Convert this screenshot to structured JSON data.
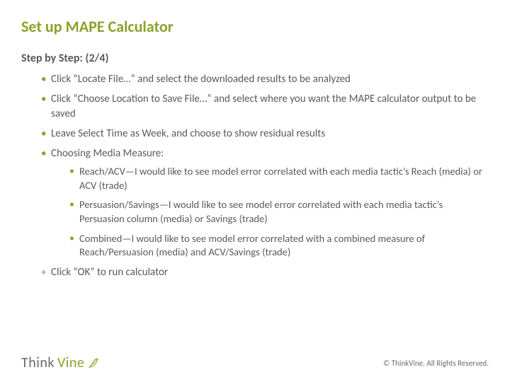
{
  "title": "Set up MAPE Calculator",
  "subtitle": "Step by Step: (2/4)",
  "bullets": {
    "b1": "Click “Locate File…” and select the downloaded results to be analyzed",
    "b2": "Click “Choose Location to Save File…” and select where you want the MAPE calculator output to be saved",
    "b3": "Leave Select Time as Week, and choose to show residual results",
    "b4": "Choosing Media Measure:",
    "b4a": "Reach/ACV—I would like to see model error correlated with each media tactic’s Reach (media) or ACV (trade)",
    "b4b": "Persuasion/Savings—I would like to see model error correlated with each media tactic’s Persuasion column (media) or Savings (trade)",
    "b4c": "Combined—I would like to see model error correlated with a combined measure of Reach/Persuasion (media) and ACV/Savings (trade)",
    "b5": "Click “OK” to run calculator"
  },
  "logo": {
    "part1": "Think",
    "part2": "Vine"
  },
  "copyright": "© ThinkVine.   All Rights Reserved."
}
